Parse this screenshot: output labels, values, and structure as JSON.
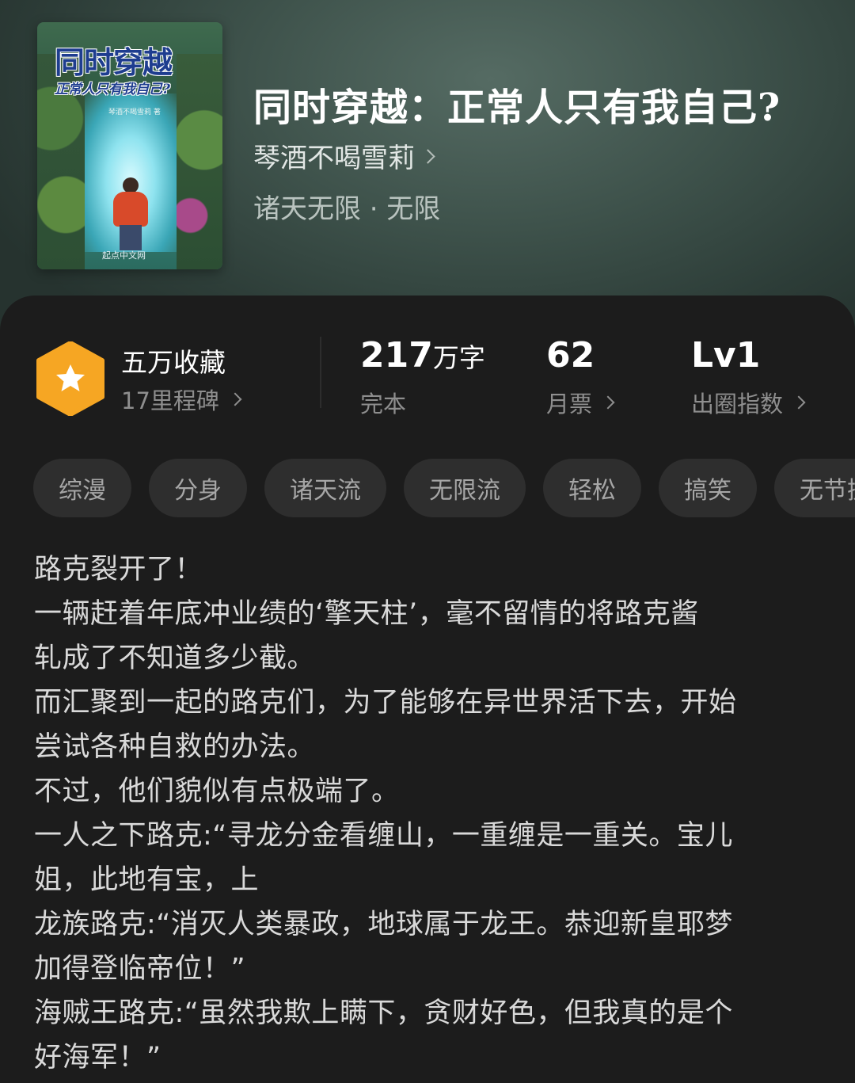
{
  "book": {
    "title": "同时穿越：正常人只有我自己?",
    "author": "琴酒不喝雪莉",
    "genre": "诸天无限 · 无限"
  },
  "cover": {
    "title_line1": "同时穿越",
    "title_line2": "正常人只有我自己?",
    "author": "琴酒不喝雪莉 著",
    "publisher": "起点中文网"
  },
  "stats": {
    "collection": {
      "title": "五万收藏",
      "sub": "17里程碑"
    },
    "words": {
      "value": "217",
      "unit": "万字",
      "sub": "完本"
    },
    "votes": {
      "value": "62",
      "sub": "月票"
    },
    "index": {
      "value": "Lv1",
      "sub": "出圈指数"
    }
  },
  "tags": [
    "综漫",
    "分身",
    "诸天流",
    "无限流",
    "轻松",
    "搞笑",
    "无节操"
  ],
  "description": [
    "路克裂开了！",
    "一辆赶着年底冲业绩的‘擎天柱’，毫不留情的将路克酱",
    "轧成了不知道多少截。",
    "而汇聚到一起的路克们，为了能够在异世界活下去，开始",
    "尝试各种自救的办法。",
    "不过，他们貌似有点极端了。",
    "一人之下路克:“寻龙分金看缠山，一重缠是一重关。宝儿",
    "姐，此地有宝，上",
    "龙族路克:“消灭人类暴政，地球属于龙王。恭迎新皇耶梦",
    "加得登临帝位！”",
    "海贼王路克:“虽然我欺上瞒下，贪财好色，但我真的是个",
    "好海军！”"
  ],
  "colors": {
    "panel_bg": "#1c1c1c",
    "badge": "#f6a623",
    "tag_bg": "#2e2e2e"
  }
}
